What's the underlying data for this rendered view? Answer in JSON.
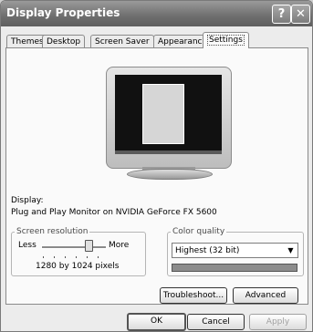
{
  "window": {
    "title": "Display Properties",
    "help_btn": "?",
    "close_btn": "✕"
  },
  "tabs": [
    {
      "label": "Themes"
    },
    {
      "label": "Desktop"
    },
    {
      "label": "Screen Saver"
    },
    {
      "label": "Appearance"
    },
    {
      "label": "Settings",
      "active": true
    }
  ],
  "display": {
    "label": "Display:",
    "value": "Plug and Play Monitor on NVIDIA GeForce FX 5600"
  },
  "resolution": {
    "legend": "Screen resolution",
    "less": "Less",
    "more": "More",
    "value": "1280 by 1024 pixels",
    "slider_position": 0.75
  },
  "color_quality": {
    "legend": "Color quality",
    "selected": "Highest (32 bit)",
    "arrow": "▼"
  },
  "buttons": {
    "troubleshoot": "Troubleshoot...",
    "advanced": "Advanced",
    "ok": "OK",
    "cancel": "Cancel",
    "apply": "Apply"
  }
}
